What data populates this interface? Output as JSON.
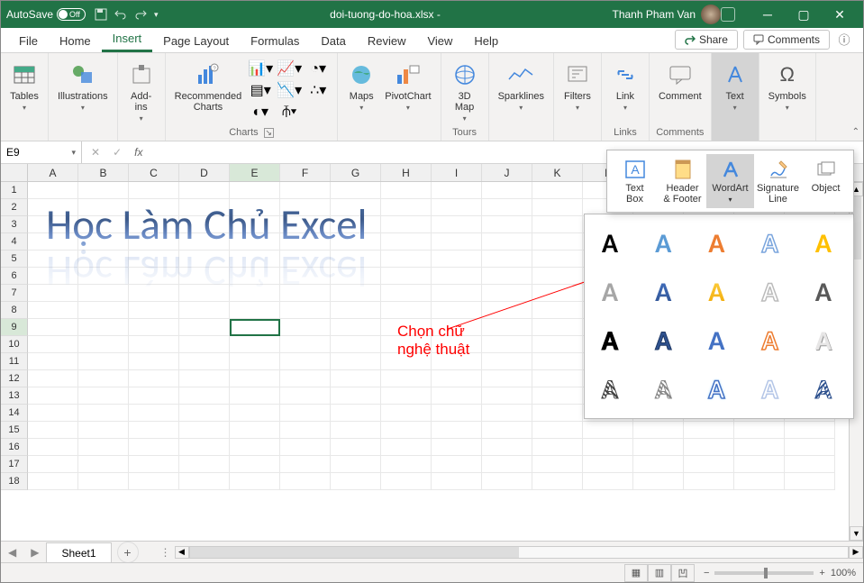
{
  "titlebar": {
    "autosave": "AutoSave",
    "toggle_state": "Off",
    "docname": "doi-tuong-do-hoa.xlsx  -",
    "username": "Thanh Pham Van"
  },
  "tabs": {
    "items": [
      "File",
      "Home",
      "Insert",
      "Page Layout",
      "Formulas",
      "Data",
      "Review",
      "View",
      "Help"
    ],
    "active_index": 2,
    "share": "Share",
    "comments": "Comments"
  },
  "ribbon": {
    "groups": [
      {
        "label": "",
        "buttons": [
          {
            "l": "Tables"
          }
        ]
      },
      {
        "label": "",
        "buttons": [
          {
            "l": "Illustrations"
          }
        ]
      },
      {
        "label": "",
        "buttons": [
          {
            "l": "Add-\nins"
          }
        ]
      },
      {
        "label": "Charts",
        "buttons": [
          {
            "l": "Recommended\nCharts"
          }
        ],
        "has_launcher": true
      },
      {
        "label": "",
        "buttons": [
          {
            "l": "Maps"
          },
          {
            "l": "PivotChart"
          }
        ]
      },
      {
        "label": "Tours",
        "buttons": [
          {
            "l": "3D\nMap"
          }
        ]
      },
      {
        "label": "Sparklines",
        "buttons": [
          {
            "l": "Sparklines"
          }
        ]
      },
      {
        "label": "",
        "buttons": [
          {
            "l": "Filters"
          }
        ]
      },
      {
        "label": "Links",
        "buttons": [
          {
            "l": "Link"
          }
        ]
      },
      {
        "label": "Comments",
        "buttons": [
          {
            "l": "Comment"
          }
        ]
      },
      {
        "label": "",
        "buttons": [
          {
            "l": "Text"
          }
        ]
      },
      {
        "label": "",
        "buttons": [
          {
            "l": "Symbols"
          }
        ]
      }
    ]
  },
  "namebox": {
    "ref": "E9"
  },
  "columns": [
    "A",
    "B",
    "C",
    "D",
    "E",
    "F",
    "G",
    "H",
    "I",
    "J",
    "K",
    "L",
    "M",
    "N",
    "O",
    "P"
  ],
  "rows_visible": 18,
  "selected_cell": {
    "col": "E",
    "row": 9
  },
  "wordart_content": "Học Làm Chủ Excel",
  "annotation_text": "Chọn chữ\nnghệ thuật",
  "text_dropdown": {
    "items": [
      {
        "l": "Text\nBox"
      },
      {
        "l": "Header\n& Footer"
      },
      {
        "l": "WordArt",
        "active": true,
        "drop": true
      },
      {
        "l": "Signature\nLine",
        "drop": true
      },
      {
        "l": "Object"
      }
    ]
  },
  "wordart_gallery_rows": 4,
  "wordart_gallery_cols": 5,
  "sheettabs": {
    "active": "Sheet1"
  },
  "statusbar": {
    "zoom": "100%"
  }
}
